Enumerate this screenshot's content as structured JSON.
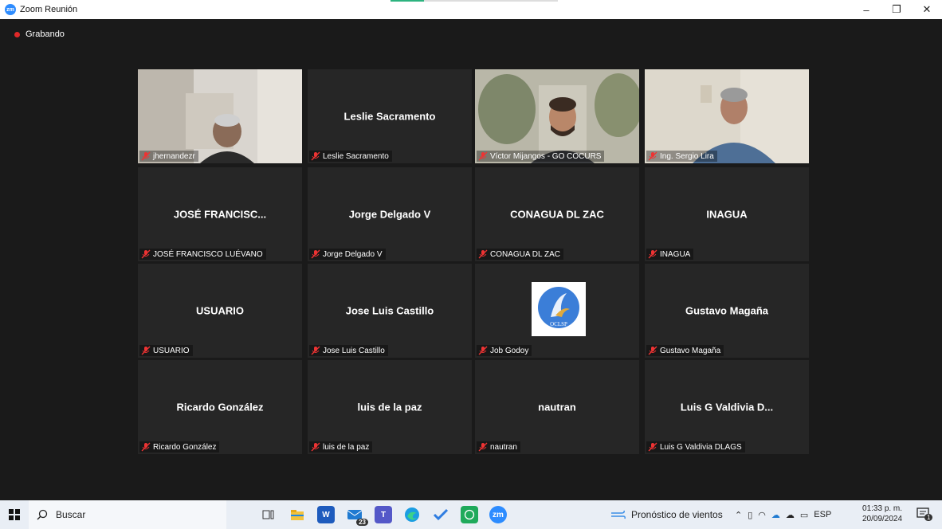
{
  "window": {
    "title": "Zoom Reunión",
    "app_icon": "zm",
    "controls": {
      "minimize": "–",
      "restore": "❐",
      "close": "✕"
    }
  },
  "meeting": {
    "recording_label": "Grabando",
    "participants": [
      {
        "label": "jhernandezr",
        "center_name": "",
        "video": true
      },
      {
        "label": "Leslie Sacramento",
        "center_name": "Leslie Sacramento",
        "video": false
      },
      {
        "label": "Víctor Mijangos - GO COCURS",
        "center_name": "",
        "video": true,
        "active_speaker": true
      },
      {
        "label": "Ing. Sergio Lira",
        "center_name": "",
        "video": true
      },
      {
        "label": "JOSÉ FRANCISCO LUÉVANO",
        "center_name": "JOSÉ FRANCISC...",
        "video": false
      },
      {
        "label": "Jorge Delgado V",
        "center_name": "Jorge Delgado V",
        "video": false
      },
      {
        "label": "CONAGUA DL ZAC",
        "center_name": "CONAGUA DL ZAC",
        "video": false
      },
      {
        "label": "INAGUA",
        "center_name": "INAGUA",
        "video": false
      },
      {
        "label": "USUARIO",
        "center_name": "USUARIO",
        "video": false
      },
      {
        "label": "Jose Luis Castillo",
        "center_name": "Jose Luis Castillo",
        "video": false
      },
      {
        "label": "Job Godoy",
        "center_name": "",
        "video": false,
        "avatar_text": "OCLSP"
      },
      {
        "label": "Gustavo Magaña",
        "center_name": "Gustavo Magaña",
        "video": false
      },
      {
        "label": "Ricardo González",
        "center_name": "Ricardo González",
        "video": false
      },
      {
        "label": "luis de la paz",
        "center_name": "luis de la paz",
        "video": false
      },
      {
        "label": "nautran",
        "center_name": "nautran",
        "video": false
      },
      {
        "label": "Luis G Valdivia DLAGS",
        "center_name": "Luis G Valdivia D...",
        "video": false
      }
    ]
  },
  "taskbar": {
    "search_label": "Buscar",
    "mail_badge": "23",
    "weather_label": "Pronóstico de vientos",
    "language": "ESP",
    "time": "01:33 p. m.",
    "date": "20/09/2024",
    "notification_count": "1"
  },
  "colors": {
    "active_border": "#b7e34f",
    "recording": "#e02828",
    "zoom_blue": "#2d8cff",
    "tile_bg": "#262626"
  }
}
